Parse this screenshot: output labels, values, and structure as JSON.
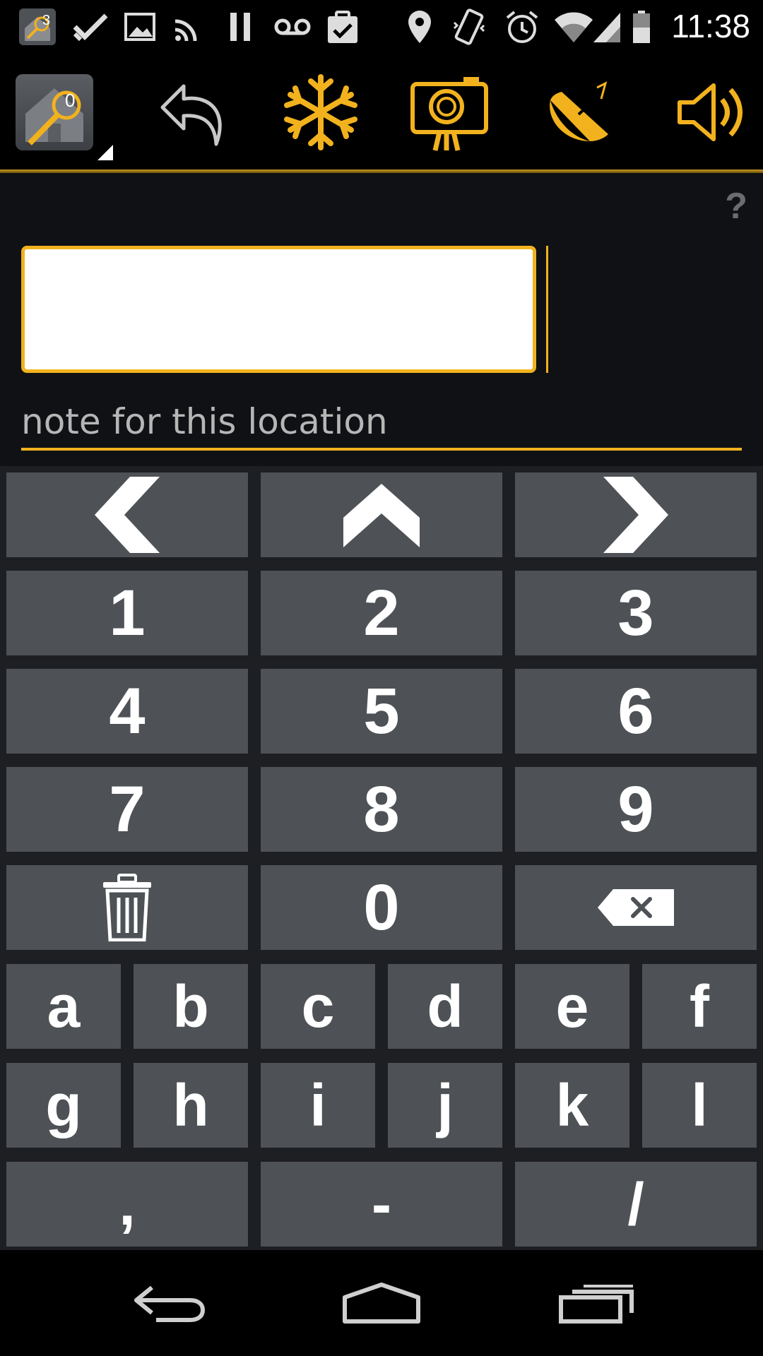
{
  "status_bar": {
    "time": "11:38",
    "notification_badge": "3",
    "icons": [
      "app-notification-icon",
      "checkmark-icon",
      "image-icon",
      "cast-icon",
      "pause-icon",
      "voicemail-icon",
      "clipboard-check-icon",
      "location-pin-icon",
      "vibrate-icon",
      "alarm-icon",
      "wifi-icon",
      "signal-icon",
      "battery-icon"
    ]
  },
  "toolbar": {
    "home_badge": "0",
    "icons": [
      "home-search-icon",
      "undo-icon",
      "snowflake-icon",
      "camera-icon",
      "satellite-dish-icon",
      "speaker-icon"
    ]
  },
  "help": {
    "label": "?"
  },
  "input": {
    "value": "",
    "placeholder": ""
  },
  "note": {
    "label": "note for this location"
  },
  "keypad": {
    "nav_keys": [
      "left-arrow-icon",
      "up-arrow-icon",
      "right-arrow-icon"
    ],
    "digits": [
      "1",
      "2",
      "3",
      "4",
      "5",
      "6",
      "7",
      "8",
      "9"
    ],
    "zero": "0",
    "letters_row1": [
      "a",
      "b",
      "c",
      "d",
      "e",
      "f"
    ],
    "letters_row2": [
      "g",
      "h",
      "i",
      "j",
      "k",
      "l"
    ],
    "punct": [
      ",",
      "-",
      "/"
    ]
  },
  "colors": {
    "accent": "#f2b21e",
    "key_bg": "#4e5155",
    "background": "#101114"
  },
  "nav_bar": {
    "icons": [
      "back-icon",
      "home-icon",
      "recents-icon"
    ]
  }
}
